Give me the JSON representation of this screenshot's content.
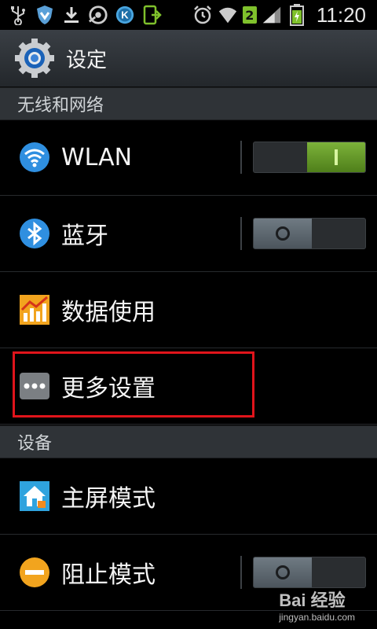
{
  "status_bar": {
    "time": "11:20",
    "sim_badge": "2",
    "icons": [
      "usb-icon",
      "shield-icon",
      "download-icon",
      "headset-icon",
      "k-app-icon",
      "install-icon",
      "alarm-icon",
      "wifi-icon",
      "signal-icon",
      "battery-icon"
    ]
  },
  "title_bar": {
    "title": "设定",
    "icon": "settings-gear-icon"
  },
  "sections": {
    "wireless": "无线和网络",
    "device": "设备"
  },
  "rows": {
    "wlan": {
      "label": "WLAN",
      "icon": "wifi-icon",
      "toggle_on": true
    },
    "bluetooth": {
      "label": "蓝牙",
      "icon": "bluetooth-icon",
      "toggle_on": false
    },
    "data_usage": {
      "label": "数据使用",
      "icon": "data-usage-chart-icon"
    },
    "more_settings": {
      "label": "更多设置",
      "icon": "more-dots-icon",
      "highlighted": true
    },
    "home_mode": {
      "label": "主屏模式",
      "icon": "home-mode-icon"
    },
    "block_mode": {
      "label": "阻止模式",
      "icon": "block-mode-icon",
      "toggle_on": false
    }
  },
  "watermark": {
    "main": "Bai 经验",
    "sub": "jingyan.baidu.com"
  },
  "colors": {
    "toggle_on": "#6aa12a",
    "highlight": "#e0141b",
    "section_bg": "#2f3337"
  }
}
